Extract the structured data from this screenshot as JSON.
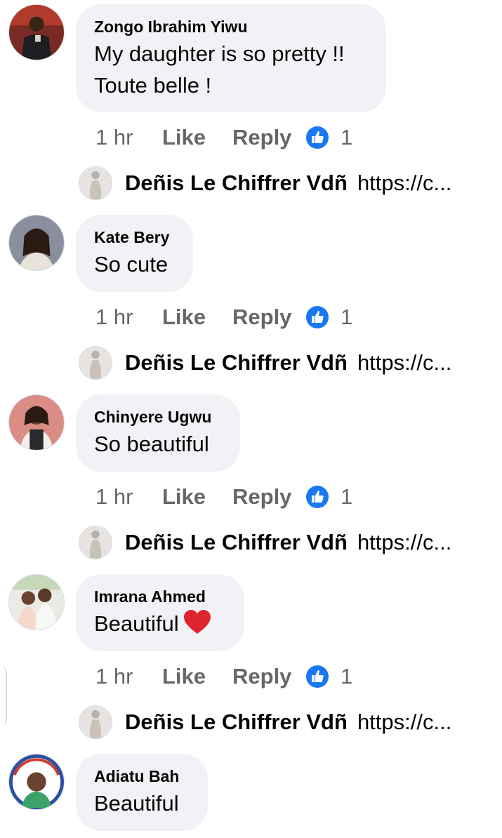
{
  "comments": [
    {
      "author": "Zongo Ibrahim Yiwu",
      "text_lines": [
        "My daughter is so pretty !!",
        "Toute belle !"
      ],
      "time": "1 hr",
      "like_label": "Like",
      "reply_label": "Reply",
      "reaction_count": "1",
      "reply": {
        "author": "Deñis Le Chiffrer Vdñ",
        "preview": "https://c..."
      }
    },
    {
      "author": "Kate Bery",
      "text_lines": [
        "So cute"
      ],
      "time": "1 hr",
      "like_label": "Like",
      "reply_label": "Reply",
      "reaction_count": "1",
      "reply": {
        "author": "Deñis Le Chiffrer Vdñ",
        "preview": "https://c..."
      }
    },
    {
      "author": "Chinyere Ugwu",
      "text_lines": [
        "So beautiful"
      ],
      "time": "1 hr",
      "like_label": "Like",
      "reply_label": "Reply",
      "reaction_count": "1",
      "reply": {
        "author": "Deñis Le Chiffrer Vdñ",
        "preview": "https://c..."
      }
    },
    {
      "author": "Imrana Ahmed",
      "text_lines": [
        "Beautiful"
      ],
      "emoji": "red-heart-icon",
      "time": "1 hr",
      "like_label": "Like",
      "reply_label": "Reply",
      "reaction_count": "1",
      "reply": {
        "author": "Deñis Le Chiffrer Vdñ",
        "preview": "https://c..."
      }
    },
    {
      "author": "Adiatu Bah",
      "text_lines": [
        "Beautiful"
      ]
    }
  ],
  "colors": {
    "bubble_bg": "#f0f2f5",
    "meta_text": "#65676b",
    "like_blue": "#1877f2",
    "heart_red": "#e0242f"
  }
}
